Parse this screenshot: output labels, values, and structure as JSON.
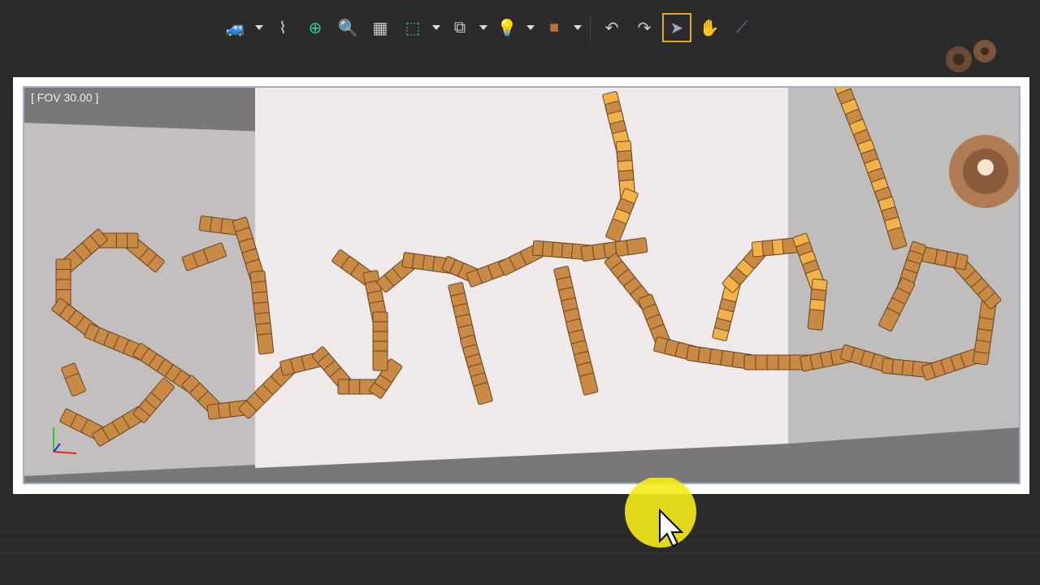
{
  "toolbar": {
    "items": [
      {
        "name": "camera-car-icon",
        "dropdown": true
      },
      {
        "name": "spline-light-icon",
        "dropdown": false
      },
      {
        "name": "frame-all-icon",
        "dropdown": false
      },
      {
        "name": "zoom-icon",
        "dropdown": false
      },
      {
        "name": "grid-floor-icon",
        "dropdown": false
      },
      {
        "name": "rectangle-select-icon",
        "dropdown": true
      },
      {
        "name": "copy-transform-icon",
        "dropdown": true
      },
      {
        "name": "light-bulb-icon",
        "dropdown": true
      },
      {
        "name": "cube-icon",
        "dropdown": true
      },
      {
        "name": "undo-icon",
        "dropdown": false
      },
      {
        "name": "redo-icon",
        "dropdown": false
      },
      {
        "name": "select-arrow-icon",
        "dropdown": false,
        "active": true
      },
      {
        "name": "hand-pan-icon",
        "dropdown": false
      },
      {
        "name": "axis-add-remove-icon",
        "dropdown": false
      }
    ],
    "active_color": "#e6a623"
  },
  "viewport": {
    "fov_label": "[ FOV 30.00 ]",
    "domino_color": "#c98a45",
    "highlight_color": "#f2b24a"
  },
  "cursor": {
    "highlight_color": "#f5ea1a"
  }
}
